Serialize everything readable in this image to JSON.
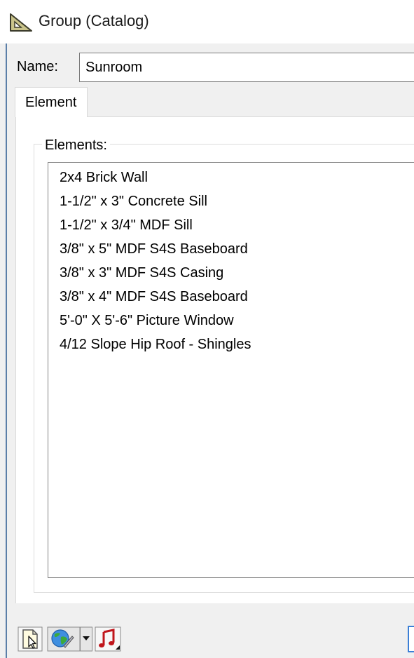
{
  "window": {
    "title": "Group (Catalog)",
    "title_icon": "catalog-group-icon"
  },
  "name_field": {
    "label": "Name:",
    "value": "Sunroom"
  },
  "tabs": [
    {
      "label": "Element",
      "active": true
    }
  ],
  "elements_group": {
    "title": "Elements:",
    "items": [
      "2x4  Brick Wall",
      "1-1/2\" x 3\" Concrete Sill",
      "1-1/2\" x 3/4\" MDF Sill",
      "3/8\" x 5\" MDF S4S Baseboard",
      "3/8\" x 3\" MDF S4S Casing",
      "3/8\" x 4\" MDF S4S Baseboard",
      "5'-0\" X 5'-6\" Picture Window",
      "4/12 Slope Hip Roof - Shingles"
    ]
  },
  "bottom_toolbar": {
    "buttons": [
      {
        "icon": "new-document-cursor-icon"
      },
      {
        "icon": "globe-web-icon"
      },
      {
        "icon": "dropdown-arrow-icon"
      },
      {
        "icon": "music-note-icon"
      }
    ]
  },
  "colors": {
    "window_background": "#f0f0f0",
    "panel_background": "#ffffff",
    "frame_accent": "#5b7fa8",
    "focus_blue": "#3c7fd6",
    "music_icon_red": "#c0151b"
  }
}
